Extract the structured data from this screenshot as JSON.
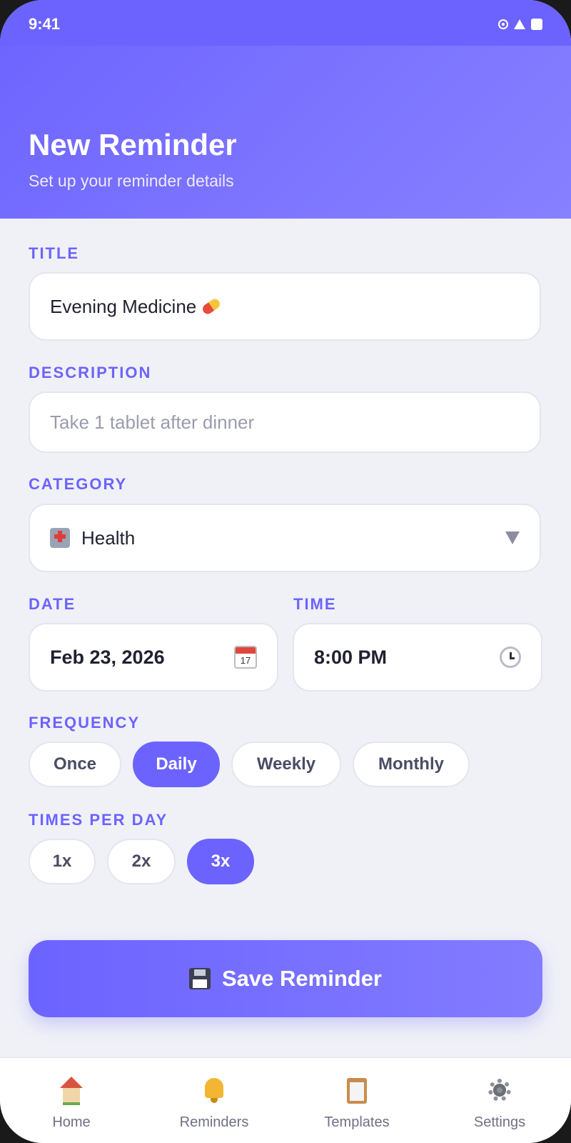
{
  "status_bar": {
    "time": "9:41"
  },
  "header": {
    "title": "New Reminder",
    "subtitle": "Set up your reminder details"
  },
  "form": {
    "title_label": "TITLE",
    "title_value": "Evening Medicine",
    "title_icon": "pill-icon",
    "description_label": "DESCRIPTION",
    "description_placeholder": "Take 1 tablet after dinner",
    "category_label": "CATEGORY",
    "category_value": "Health",
    "category_icon": "hospital-icon",
    "date_label": "DATE",
    "date_value": "Feb 23, 2026",
    "date_icon_day": "17",
    "time_label": "TIME",
    "time_value": "8:00 PM",
    "frequency_label": "FREQUENCY",
    "frequency_options": [
      "Once",
      "Daily",
      "Weekly",
      "Monthly"
    ],
    "frequency_selected": "Daily",
    "times_label": "TIMES PER DAY",
    "times_options": [
      "1x",
      "2x",
      "3x"
    ],
    "times_selected": "3x"
  },
  "save_button": {
    "label": "Save Reminder",
    "icon": "floppy-disk-icon"
  },
  "bottom_nav": {
    "items": [
      {
        "label": "Home",
        "icon": "home-icon"
      },
      {
        "label": "Reminders",
        "icon": "bell-icon"
      },
      {
        "label": "Templates",
        "icon": "clipboard-icon"
      },
      {
        "label": "Settings",
        "icon": "gear-icon"
      }
    ]
  },
  "colors": {
    "accent": "#6c63ff",
    "background": "#f0f1f7",
    "label": "#6c63ff"
  }
}
